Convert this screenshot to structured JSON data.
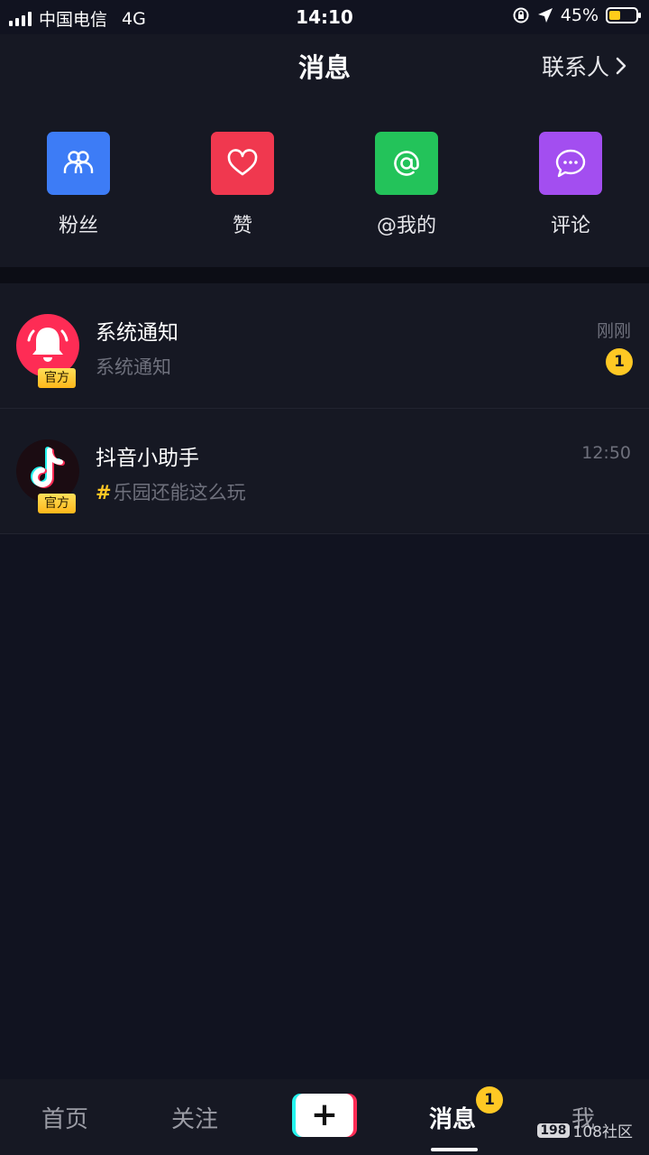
{
  "status_bar": {
    "carrier": "中国电信",
    "network": "4G",
    "time": "14:10",
    "battery_percent": "45%",
    "battery_level": 0.45
  },
  "header": {
    "title": "消息",
    "contacts_label": "联系人"
  },
  "quick_actions": [
    {
      "label": "粉丝",
      "icon": "fans-icon",
      "color": "#3d7cf6"
    },
    {
      "label": "赞",
      "icon": "heart-icon",
      "color": "#f0384f"
    },
    {
      "label": "@我的",
      "icon": "at-icon",
      "color": "#23c35a"
    },
    {
      "label": "评论",
      "icon": "comment-icon",
      "color": "#a34ef0"
    }
  ],
  "messages": [
    {
      "name": "系统通知",
      "preview": "系统通知",
      "time": "刚刚",
      "badge": "官方",
      "unread": "1"
    },
    {
      "name": "抖音小助手",
      "hashtag": "#",
      "preview": "乐园还能这么玩",
      "time": "12:50",
      "badge": "官方"
    }
  ],
  "tabbar": {
    "tabs": [
      "首页",
      "关注",
      "消息",
      "我"
    ],
    "create_symbol": "+",
    "messages_badge": "1",
    "watermark_logo": "198",
    "watermark_text": "108社区"
  },
  "colors": {
    "accent_yellow": "#ffc824",
    "background": "#111320",
    "panel": "#161823"
  }
}
